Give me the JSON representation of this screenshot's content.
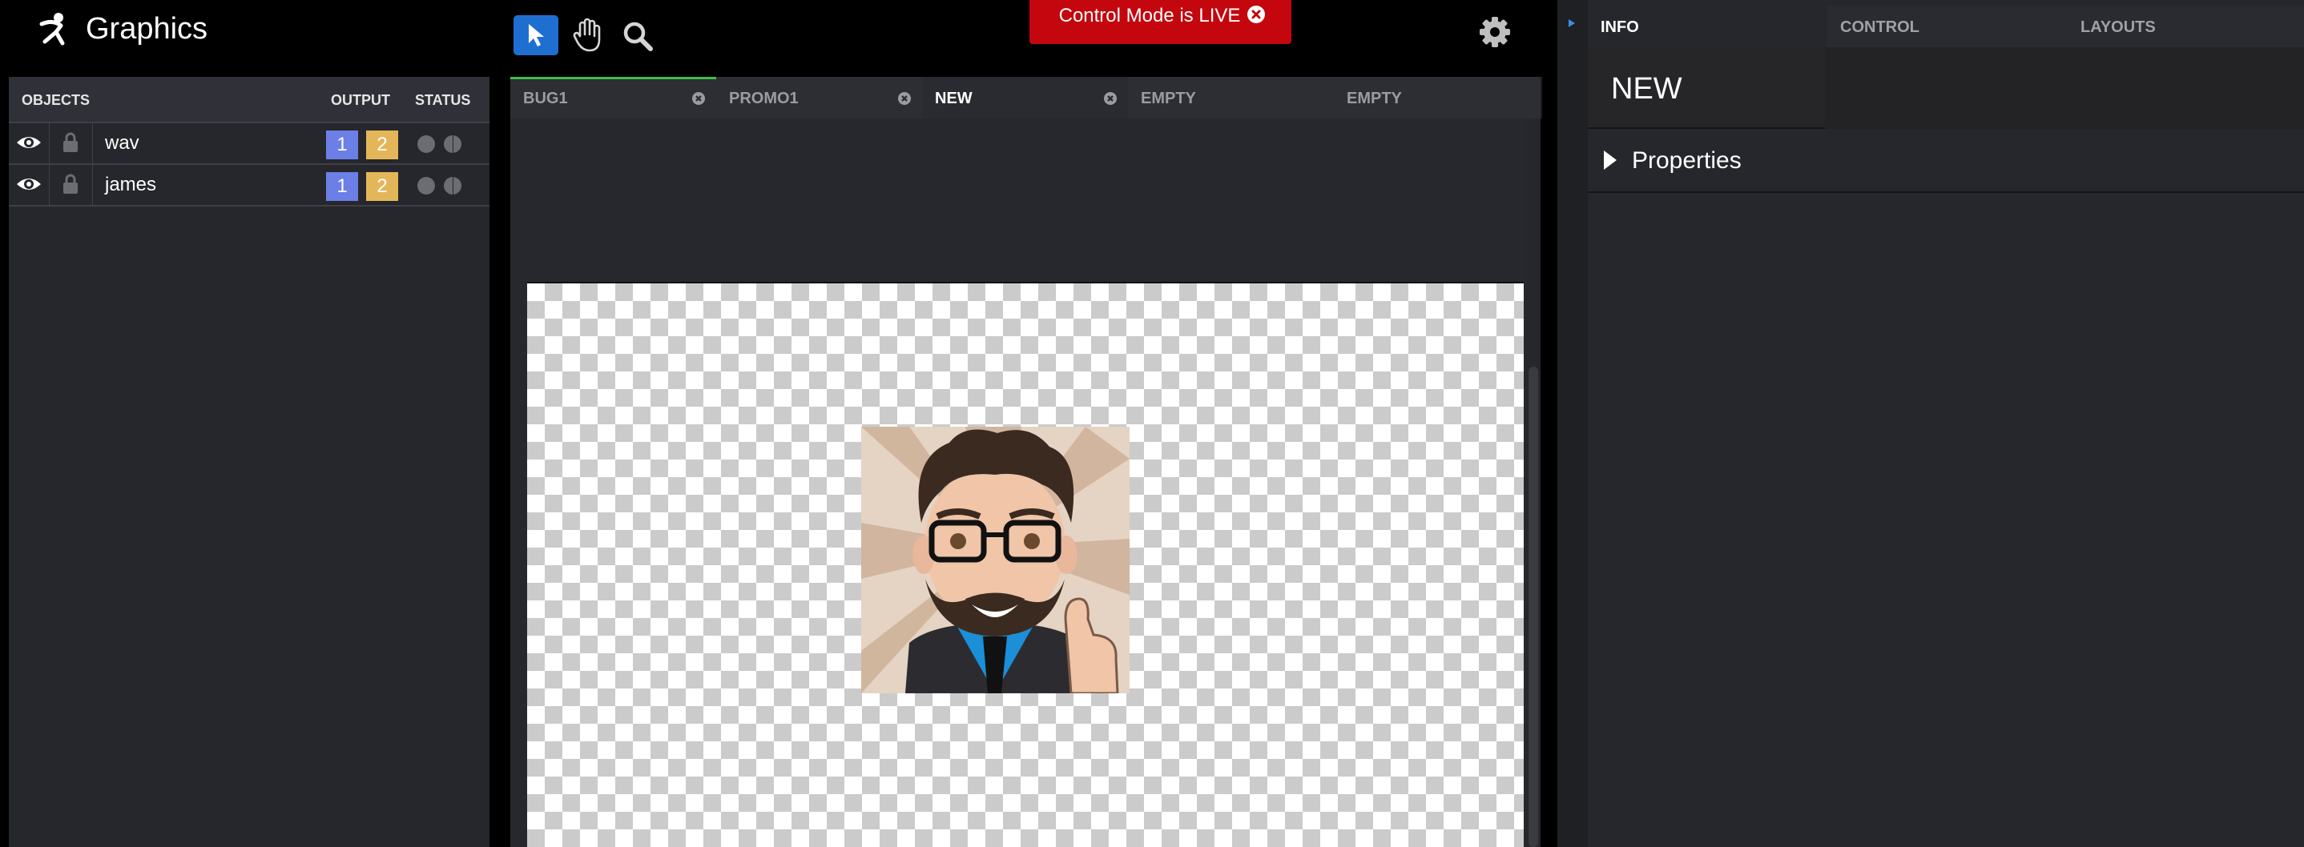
{
  "app": {
    "title": "Graphics"
  },
  "objects_panel": {
    "headers": {
      "objects": "OBJECTS",
      "output": "OUTPUT",
      "status": "STATUS"
    },
    "rows": [
      {
        "name": "wav",
        "outputs": [
          "1",
          "2"
        ]
      },
      {
        "name": "james",
        "outputs": [
          "1",
          "2"
        ]
      }
    ]
  },
  "toolbar": {
    "tools": [
      "select-tool",
      "hand-tool",
      "zoom-tool"
    ],
    "live_banner": "Control Mode is LIVE"
  },
  "tabs": [
    {
      "label": "BUG1",
      "closable": true
    },
    {
      "label": "PROMO1",
      "closable": true
    },
    {
      "label": "NEW",
      "closable": true,
      "active": true
    },
    {
      "label": "EMPTY",
      "closable": false
    },
    {
      "label": "EMPTY",
      "closable": false
    }
  ],
  "right_panel": {
    "tabs": [
      {
        "label": "INFO",
        "active": true
      },
      {
        "label": "CONTROL"
      },
      {
        "label": "LAYOUTS"
      }
    ],
    "info_title": "NEW",
    "properties_label": "Properties"
  },
  "colors": {
    "output_1": "#6c7fe6",
    "output_2": "#e4b65a",
    "live_banner": "#c4060e",
    "tool_active": "#1f6fd1",
    "tab_accent": "#3fbf4a"
  }
}
